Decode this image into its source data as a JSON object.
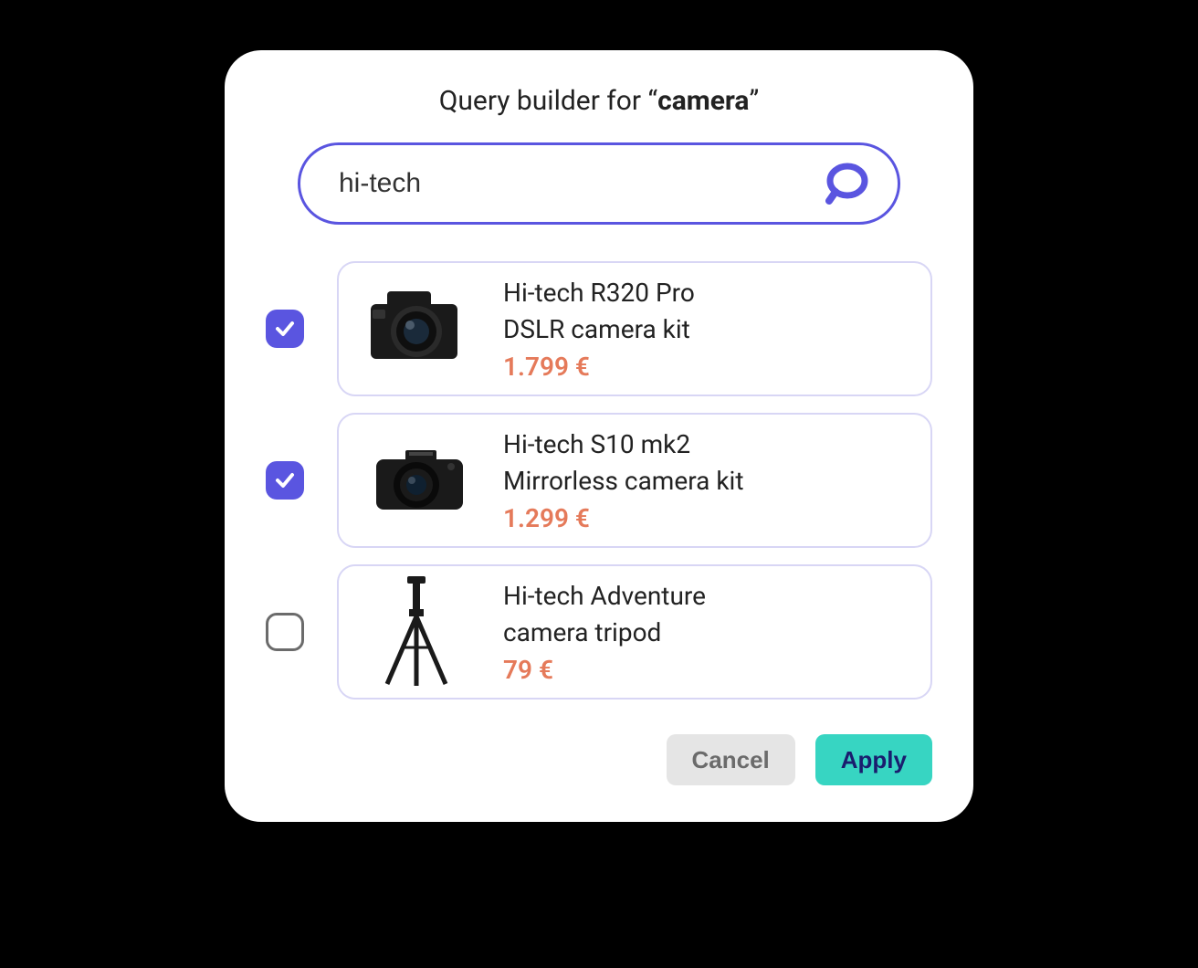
{
  "header": {
    "title_prefix": "Query builder for “",
    "query_term": "camera",
    "title_suffix": "”"
  },
  "search": {
    "value": "hi-tech",
    "placeholder": ""
  },
  "results": [
    {
      "checked": true,
      "icon": "dslr-camera",
      "line1": "Hi-tech R320 Pro",
      "line2": "DSLR camera kit",
      "price": "1.799 €"
    },
    {
      "checked": true,
      "icon": "mirrorless-camera",
      "line1": "Hi-tech S10 mk2",
      "line2": "Mirrorless camera kit",
      "price": "1.299 €"
    },
    {
      "checked": false,
      "icon": "tripod",
      "line1": "Hi-tech Adventure",
      "line2": "camera tripod",
      "price": "79 €"
    }
  ],
  "actions": {
    "cancel_label": "Cancel",
    "apply_label": "Apply"
  },
  "colors": {
    "accent": "#5a55e0",
    "price": "#e57a5a",
    "apply_bg": "#37d5c2",
    "apply_fg": "#1a1d6e"
  }
}
